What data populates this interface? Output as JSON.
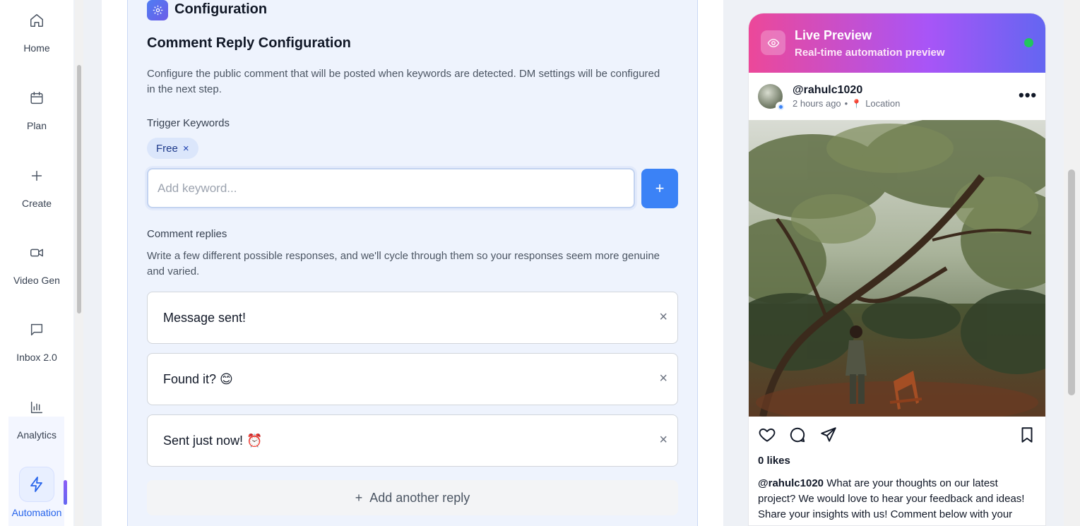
{
  "sidebar": {
    "items": [
      {
        "label": "Home",
        "icon": "home-icon"
      },
      {
        "label": "Plan",
        "icon": "calendar-icon"
      },
      {
        "label": "Create",
        "icon": "plus-icon"
      },
      {
        "label": "Video Gen",
        "icon": "video-icon"
      },
      {
        "label": "Inbox 2.0",
        "icon": "message-icon"
      },
      {
        "label": "Analytics",
        "icon": "bar-chart-icon"
      },
      {
        "label": "Automation",
        "icon": "lightning-icon"
      }
    ],
    "active_color": "#2563eb"
  },
  "config": {
    "header": "Configuration",
    "section_title": "Comment Reply Configuration",
    "description": "Configure the public comment that will be posted when keywords are detected. DM settings will be configured in the next step.",
    "keywords_label": "Trigger Keywords",
    "keywords": [
      "Free"
    ],
    "keyword_placeholder": "Add keyword...",
    "add_keyword_symbol": "+",
    "replies_label": "Comment replies",
    "replies_help": "Write a few different possible responses, and we'll cycle through them so your responses seem more genuine and varied.",
    "replies": [
      "Message sent!",
      "Found it? 😊",
      "Sent just now! ⏰"
    ],
    "remove_symbol": "×",
    "add_reply_label": "Add another reply"
  },
  "preview": {
    "title": "Live Preview",
    "subtitle": "Real-time automation preview",
    "status_color": "#22c55e",
    "username": "@rahulc1020",
    "time": "2 hours ago",
    "separator": "•",
    "location": "Location",
    "likes": "0 likes",
    "caption_user": "@rahulc1020",
    "caption_text": "What are your thoughts on our latest project? We would love to hear your feedback and ideas! Share your insights with us! Comment below with your thoughts! #fyfa"
  }
}
